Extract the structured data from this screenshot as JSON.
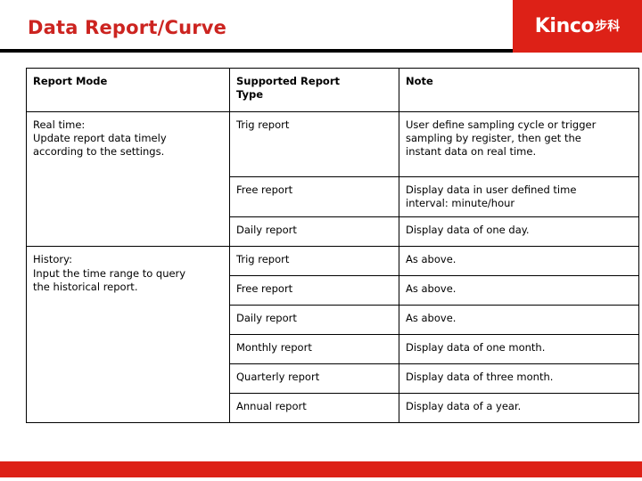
{
  "header": {
    "title": "Data Report/Curve",
    "logo_text": "Kinco",
    "logo_text_cn": "步科",
    "brand_color": "#dd2117",
    "title_color": "#cc2420"
  },
  "table": {
    "columns": [
      "Report Mode",
      "Supported Report Type",
      "Note"
    ],
    "groups": [
      {
        "mode_line1": "Real time:",
        "mode_line2": "Update report data timely",
        "mode_line3": "according to the settings.",
        "rows": [
          {
            "type": "Trig report",
            "note_line1": "User define sampling cycle or trigger",
            "note_line2": "sampling by register, then get the",
            "note_line3": "instant data on real time."
          },
          {
            "type": "Free report",
            "note_line1": "Display data in user defined time",
            "note_line2": "interval: minute/hour",
            "note_line3": ""
          },
          {
            "type": "Daily report",
            "note_line1": "Display data of one day.",
            "note_line2": "",
            "note_line3": ""
          }
        ]
      },
      {
        "mode_line1": "History:",
        "mode_line2": "Input the time range to query",
        "mode_line3": "the historical report.",
        "rows": [
          {
            "type": "Trig report",
            "note_line1": "As above.",
            "note_line2": "",
            "note_line3": ""
          },
          {
            "type": "Free report",
            "note_line1": "As above.",
            "note_line2": "",
            "note_line3": ""
          },
          {
            "type": "Daily report",
            "note_line1": "As above.",
            "note_line2": "",
            "note_line3": ""
          },
          {
            "type": "Monthly report",
            "note_line1": "Display data of one month.",
            "note_line2": "",
            "note_line3": ""
          },
          {
            "type": "Quarterly report",
            "note_line1": "Display data of three month.",
            "note_line2": "",
            "note_line3": ""
          },
          {
            "type": "Annual report",
            "note_line1": "Display data of a year.",
            "note_line2": "",
            "note_line3": ""
          }
        ]
      }
    ]
  },
  "footer": {
    "bar_color": "#dd2117"
  }
}
